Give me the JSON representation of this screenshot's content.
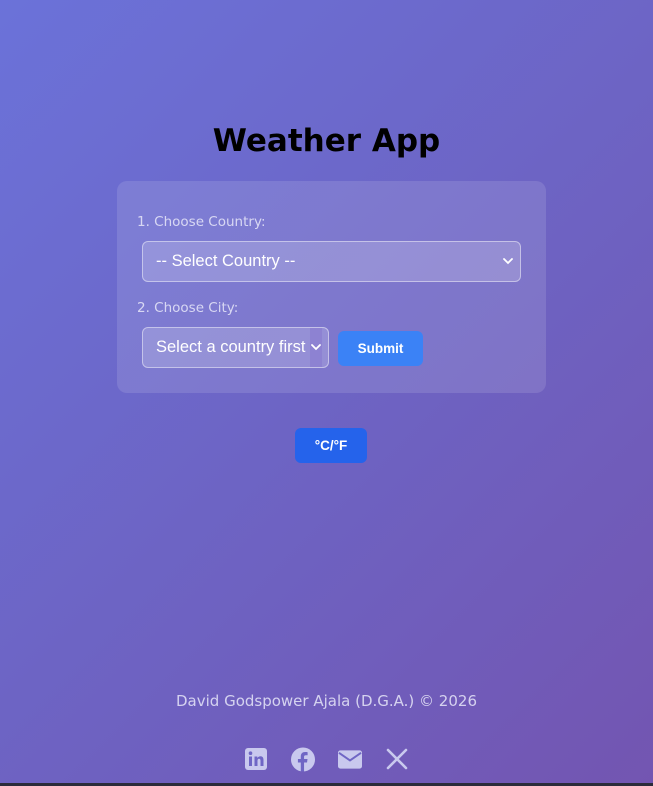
{
  "app": {
    "title": "Weather App"
  },
  "form": {
    "country_label": "1. Choose Country:",
    "country_select_value": "-- Select Country --",
    "city_label": "2. Choose City:",
    "city_select_value": "Select a country first",
    "submit_label": "Submit"
  },
  "unit_toggle": {
    "label": "°C/°F"
  },
  "footer": {
    "credit": "David Godspower Ajala (D.G.A.) © 2026",
    "socials": [
      {
        "icon": "linkedin-icon"
      },
      {
        "icon": "facebook-icon"
      },
      {
        "icon": "email-icon"
      },
      {
        "icon": "x-icon"
      }
    ]
  },
  "colors": {
    "submit_button": "#3b82f6",
    "unit_button": "#2563eb",
    "title": "#000000"
  }
}
